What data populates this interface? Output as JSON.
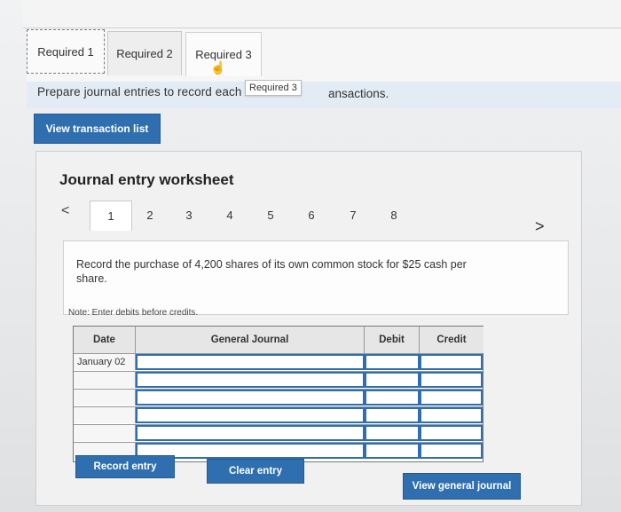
{
  "tabs": [
    {
      "label": "Required 1"
    },
    {
      "label": "Required 2"
    },
    {
      "label": "Required 3"
    }
  ],
  "instruction": {
    "text": "Prepare journal entries to record each",
    "tail": "ansactions.",
    "tooltip": "Required 3"
  },
  "buttons": {
    "view_transaction_list": "View transaction list",
    "record_entry": "Record entry",
    "clear_entry": "Clear entry",
    "view_general_journal": "View general journal"
  },
  "worksheet": {
    "title": "Journal entry worksheet",
    "steps": [
      "1",
      "2",
      "3",
      "4",
      "5",
      "6",
      "7",
      "8"
    ],
    "active_step": "1",
    "prompt": "Record the purchase of 4,200 shares of its own common stock for $25 cash per share.",
    "note": "Note: Enter debits before credits."
  },
  "journal": {
    "headers": {
      "date": "Date",
      "general_journal": "General Journal",
      "debit": "Debit",
      "credit": "Credit"
    },
    "rows": [
      {
        "date": "January 02",
        "account": "",
        "debit": "",
        "credit": ""
      },
      {
        "date": "",
        "account": "",
        "debit": "",
        "credit": ""
      },
      {
        "date": "",
        "account": "",
        "debit": "",
        "credit": ""
      },
      {
        "date": "",
        "account": "",
        "debit": "",
        "credit": ""
      },
      {
        "date": "",
        "account": "",
        "debit": "",
        "credit": ""
      },
      {
        "date": "",
        "account": "",
        "debit": "",
        "credit": ""
      }
    ]
  },
  "colors": {
    "accent": "#2f6fb0"
  },
  "icons": {
    "prev": "chevron-left-icon",
    "next": "chevron-right-icon",
    "cursor": "hand-cursor-icon"
  }
}
